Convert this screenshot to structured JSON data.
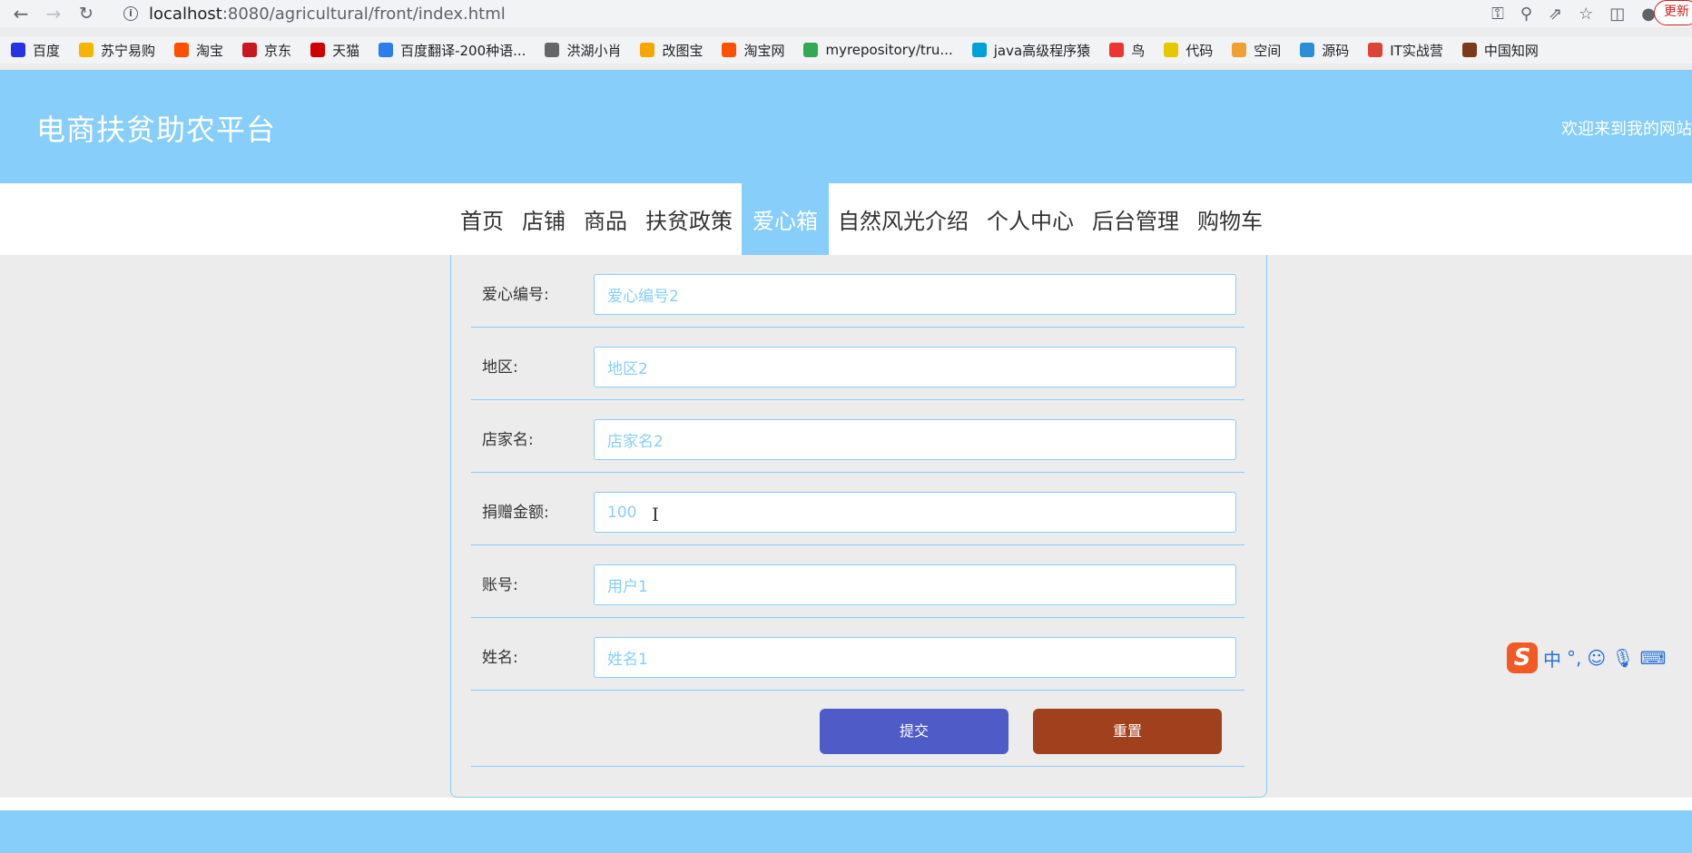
{
  "browser": {
    "url_host": "localhost",
    "url_path": ":8080/agricultural/front/index.html",
    "update_label": "更新"
  },
  "bookmarks": [
    {
      "label": "百度",
      "icon": "baidu-icon",
      "color": "#2932e1"
    },
    {
      "label": "苏宁易购",
      "icon": "suning-icon",
      "color": "#f7b500"
    },
    {
      "label": "淘宝",
      "icon": "taobao-icon",
      "color": "#ff5000"
    },
    {
      "label": "京东",
      "icon": "jd-icon",
      "color": "#c91623"
    },
    {
      "label": "天猫",
      "icon": "tmall-icon",
      "color": "#d10000"
    },
    {
      "label": "百度翻译-200种语...",
      "icon": "translate-icon",
      "color": "#2b7de9"
    },
    {
      "label": "洪湖小肖",
      "icon": "bird-icon",
      "color": "#666666"
    },
    {
      "label": "改图宝",
      "icon": "gaitubao-icon",
      "color": "#f7a600"
    },
    {
      "label": "淘宝网",
      "icon": "taobao-icon",
      "color": "#ff5000"
    },
    {
      "label": "myrepository/tru...",
      "icon": "chrome-icon",
      "color": "#34a853"
    },
    {
      "label": "java高级程序猿",
      "icon": "bilibili-icon",
      "color": "#00a1d6"
    },
    {
      "label": "鸟",
      "icon": "bird-icon",
      "color": "#e33"
    },
    {
      "label": "代码",
      "icon": "code-icon",
      "color": "#e6c700"
    },
    {
      "label": "空间",
      "icon": "qzone-icon",
      "color": "#f0a030"
    },
    {
      "label": "源码",
      "icon": "source-icon",
      "color": "#2c8fd6"
    },
    {
      "label": "IT实战营",
      "icon": "chrome-icon",
      "color": "#db4437"
    },
    {
      "label": "中国知网",
      "icon": "cnki-icon",
      "color": "#7a3b1a"
    }
  ],
  "header": {
    "title": "电商扶贫助农平台",
    "welcome": "欢迎来到我的网站"
  },
  "nav": [
    {
      "label": "首页",
      "active": false
    },
    {
      "label": "店铺",
      "active": false
    },
    {
      "label": "商品",
      "active": false
    },
    {
      "label": "扶贫政策",
      "active": false
    },
    {
      "label": "爱心箱",
      "active": true
    },
    {
      "label": "自然风光介绍",
      "active": false
    },
    {
      "label": "个人中心",
      "active": false
    },
    {
      "label": "后台管理",
      "active": false
    },
    {
      "label": "购物车",
      "active": false
    }
  ],
  "form": {
    "fields": [
      {
        "label": "爱心编号:",
        "value": "爱心编号2"
      },
      {
        "label": "地区:",
        "value": "地区2"
      },
      {
        "label": "店家名:",
        "value": "店家名2"
      },
      {
        "label": "捐赠金额:",
        "value": "100"
      },
      {
        "label": "账号:",
        "value": "用户1"
      },
      {
        "label": "姓名:",
        "value": "姓名1"
      }
    ],
    "submit_label": "提交",
    "reset_label": "重置"
  },
  "ime": {
    "logo": "S",
    "mode": "中",
    "punct": "°,"
  },
  "colors": {
    "primary": "#87cefa",
    "submit": "#4f5bc7",
    "reset": "#a0401c"
  }
}
